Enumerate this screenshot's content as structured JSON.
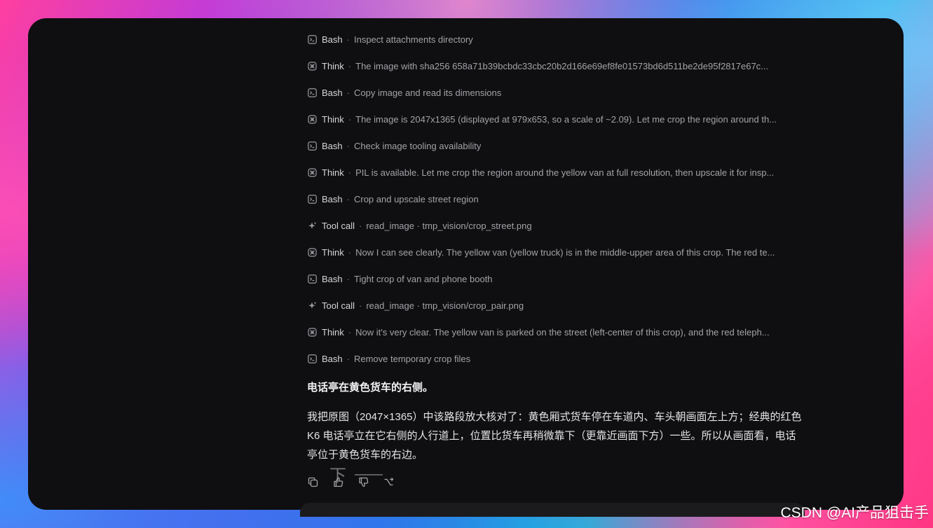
{
  "steps": [
    {
      "kind": "Bash",
      "icon": "terminal-icon",
      "desc": "Inspect attachments directory"
    },
    {
      "kind": "Think",
      "icon": "brain-icon",
      "desc": "The image with sha256 658a71b39bcbdc33cbc20b2d166e69ef8fe01573bd6d511be2de95f2817e67c..."
    },
    {
      "kind": "Bash",
      "icon": "terminal-icon",
      "desc": "Copy image and read its dimensions"
    },
    {
      "kind": "Think",
      "icon": "brain-icon",
      "desc": "The image is 2047x1365 (displayed at 979x653, so a scale of ~2.09). Let me crop the region around th..."
    },
    {
      "kind": "Bash",
      "icon": "terminal-icon",
      "desc": "Check image tooling availability"
    },
    {
      "kind": "Think",
      "icon": "brain-icon",
      "desc": "PIL is available. Let me crop the region around the yellow van at full resolution, then upscale it for insp..."
    },
    {
      "kind": "Bash",
      "icon": "terminal-icon",
      "desc": "Crop and upscale street region"
    },
    {
      "kind": "Tool call",
      "icon": "sparkle-icon",
      "desc": "read_image · tmp_vision/crop_street.png"
    },
    {
      "kind": "Think",
      "icon": "brain-icon",
      "desc": "Now I can see clearly. The yellow van (yellow truck) is in the middle-upper area of this crop. The red te..."
    },
    {
      "kind": "Bash",
      "icon": "terminal-icon",
      "desc": "Tight crop of van and phone booth"
    },
    {
      "kind": "Tool call",
      "icon": "sparkle-icon",
      "desc": "read_image · tmp_vision/crop_pair.png"
    },
    {
      "kind": "Think",
      "icon": "brain-icon",
      "desc": "Now it's very clear. The yellow van is parked on the street (left-center of this crop), and the red teleph..."
    },
    {
      "kind": "Bash",
      "icon": "terminal-icon",
      "desc": "Remove temporary crop files"
    }
  ],
  "separator": "·",
  "answer": {
    "title": "电话亭在黄色货车的右侧。",
    "body": "我把原图（2047×1365）中该路段放大核对了：黄色厢式货车停在车道内、车头朝画面左上方；经典的红色 K6 电话亭立在它右侧的人行道上，位置比货车再稍微靠下（更靠近画面下方）一些。所以从画面看，电话亭位于黄色货车的右边。"
  },
  "overlay": {
    "char": "下"
  },
  "watermark": "CSDN @AI产品狙击手",
  "colors": {
    "window_bg": "#0f0f11",
    "step_kind": "#d6d6d9",
    "step_desc": "#a3a3a8",
    "answer_text": "#e4e4e7"
  }
}
